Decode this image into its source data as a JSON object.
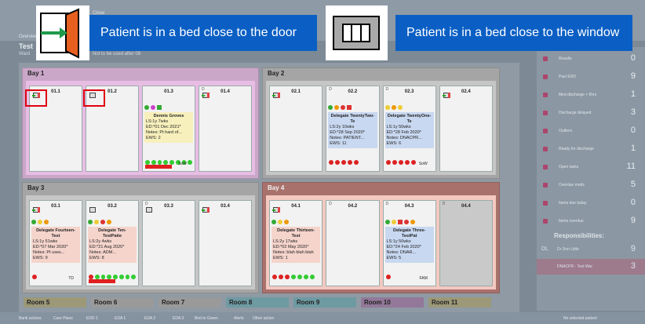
{
  "topbar": {
    "menu_close": "Close",
    "overview_tab": "Overview"
  },
  "app": {
    "title": "Test",
    "subtitle": "Ward",
    "note": "Not to be used after 08"
  },
  "tooltips": {
    "door": "Patient is in a bed close to the door",
    "window": "Patient is in a bed close to the window"
  },
  "bays": [
    {
      "title": "Bay 1",
      "beds": [
        {
          "num": "01.1",
          "icon": "door-icon",
          "highlighted": true
        },
        {
          "num": "01.2",
          "icon": "window-icon",
          "highlighted": true
        },
        {
          "num": "01.3",
          "patient": {
            "name": "Dennis Groves",
            "lines": [
              "LS:1y 7wks",
              "ED:*01 Dec 2021*",
              "Notes: Pt hard of...",
              "EWS: 2"
            ],
            "color": "yellow",
            "tag": "SoW"
          }
        },
        {
          "num": "01.4",
          "d": "D",
          "icon": "door-icon"
        }
      ]
    },
    {
      "title": "Bay 2",
      "beds": [
        {
          "num": "02.1",
          "icon": "door-icon"
        },
        {
          "num": "02.2",
          "d": "D",
          "patient": {
            "name": "Delegate TwentyTwo-Te",
            "lines": [
              "LS:2y 10wks",
              "ED:*28 Sep 2020*",
              "Notes: PATIENT...",
              "EWS: 11"
            ],
            "color": "blue"
          }
        },
        {
          "num": "02.3",
          "d": "D",
          "patient": {
            "name": "Delegate TwentyOne-Te",
            "lines": [
              "LS:1y 50wks",
              "ED:*28 Feb 2020*",
              "Notes: DNACPR...",
              "EWS: 6"
            ],
            "color": "blue",
            "tag": "SoW"
          }
        },
        {
          "num": "02.4",
          "icon": "door-icon"
        }
      ]
    },
    {
      "title": "Bay 3",
      "beds": [
        {
          "num": "03.1",
          "icon": "door-icon",
          "patient": {
            "name": "Delegate Fourteen-Test",
            "lines": [
              "LS:1y 51wks",
              "ED:*07 Mar 2020*",
              "Notes: Pt uses...",
              "EWS: 9"
            ],
            "color": "pink",
            "tag": "TD"
          }
        },
        {
          "num": "03.2",
          "icon": "window-icon",
          "patient": {
            "name": "Delegate Ten-TestPatie",
            "lines": [
              "LS:2y 4wks",
              "ED:*21 Aug 2020*",
              "Notes: ADM...",
              "EWS: 8"
            ],
            "color": "pink"
          }
        },
        {
          "num": "03.3",
          "d": "D",
          "icon": "window-icon"
        },
        {
          "num": "03.4",
          "icon": "door-icon"
        }
      ]
    },
    {
      "title": "Bay 4",
      "beds": [
        {
          "num": "04.1",
          "icon": "door-icon",
          "patient": {
            "name": "Delegate Thirteen-Test",
            "lines": [
              "LS:2y 17wks",
              "ED:*02 May 2020*",
              "Notes: blah blah blah",
              "EWS: 1"
            ],
            "color": "pink"
          }
        },
        {
          "num": "04.2",
          "d": "D"
        },
        {
          "num": "04.3",
          "d": "D",
          "patient": {
            "name": "Delegate Three-TestPat",
            "lines": [
              "LS:1y 50wks",
              "ED:*24 Feb 2020*",
              "Notes: DNAR...",
              "EWS: 5"
            ],
            "color": "blue",
            "tag": "FAM"
          }
        },
        {
          "num": "04.4",
          "d": "D"
        }
      ]
    }
  ],
  "rooms": [
    {
      "label": "Room 5",
      "color": "#9c9878"
    },
    {
      "label": "Room 6",
      "color": "#9a9a9a"
    },
    {
      "label": "Room 7",
      "color": "#9a9a9a"
    },
    {
      "label": "Room 8",
      "color": "#6e9aa2"
    },
    {
      "label": "Room 9",
      "color": "#6e9aa2"
    },
    {
      "label": "Room 10",
      "color": "#93789a"
    },
    {
      "label": "Room 11",
      "color": "#9c9878"
    }
  ],
  "sidebar": {
    "rows": [
      {
        "label": "Results",
        "count": "0"
      },
      {
        "label": "Past EDD",
        "count": "9"
      },
      {
        "label": "Med discharge + 6hrs",
        "count": "1"
      },
      {
        "label": "Discharge delayed",
        "count": "3"
      },
      {
        "label": "Outliers",
        "count": "0"
      },
      {
        "label": "Ready for discharge",
        "count": "1"
      },
      {
        "label": "Open tasks",
        "count": "11"
      },
      {
        "label": "Overdue meds",
        "count": "5"
      },
      {
        "label": "Items due today",
        "count": "0"
      },
      {
        "label": "Items overdue",
        "count": "9"
      }
    ],
    "responsibilities_title": "Responsibilities:",
    "responsibilities": [
      {
        "prefix": "DL",
        "name": "Dr Don Little",
        "count": "9"
      },
      {
        "prefix": "",
        "name": "DNACPR - Test War",
        "count": "3"
      }
    ]
  },
  "statusbar": {
    "items": [
      "Bank actions",
      "Care Plans",
      "EDD 1",
      "EDA 1",
      "EDA 2",
      "EDA 3",
      "Bed to Green",
      "Alerts",
      "Other action"
    ],
    "no_selection": "No selected patient"
  }
}
